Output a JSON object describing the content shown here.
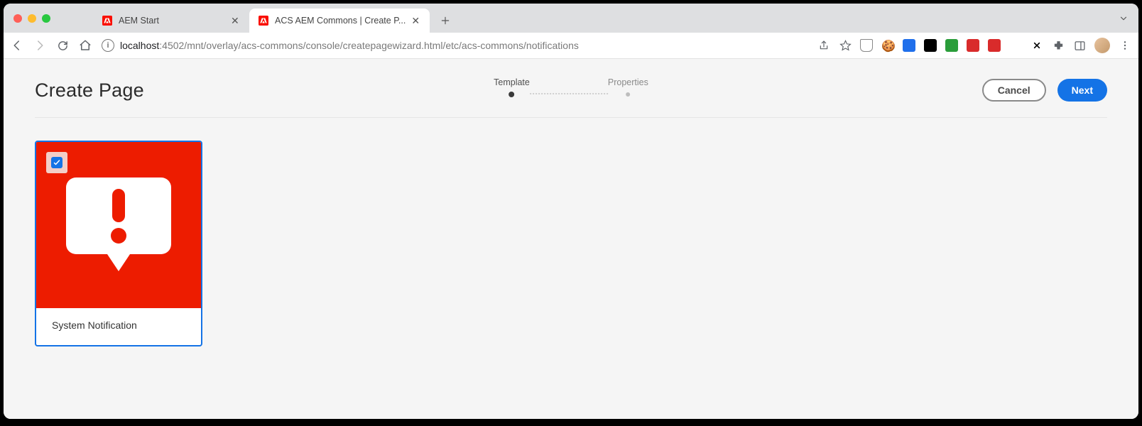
{
  "browser": {
    "tabs": [
      {
        "title": "AEM Start",
        "active": false
      },
      {
        "title": "ACS AEM Commons | Create P...",
        "active": true
      }
    ],
    "url_host": "localhost",
    "url_port_path": ":4502/mnt/overlay/acs-commons/console/createpagewizard.html/etc/acs-commons/notifications"
  },
  "page": {
    "title": "Create Page",
    "steps": {
      "step1": "Template",
      "step2": "Properties"
    },
    "actions": {
      "cancel": "Cancel",
      "next": "Next"
    },
    "template_card": {
      "title": "System Notification",
      "selected": true
    }
  }
}
